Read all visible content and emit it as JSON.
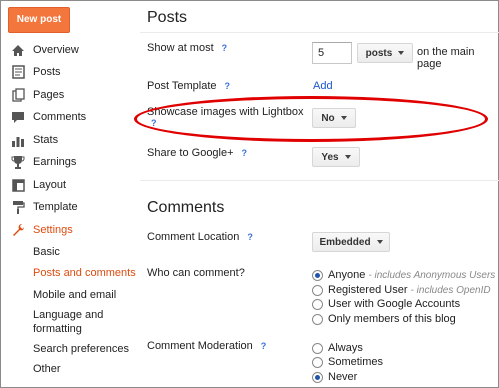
{
  "sidebar": {
    "new_post": "New post",
    "items": [
      {
        "label": "Overview",
        "icon": "home-icon"
      },
      {
        "label": "Posts",
        "icon": "posts-icon"
      },
      {
        "label": "Pages",
        "icon": "pages-icon"
      },
      {
        "label": "Comments",
        "icon": "comments-icon"
      },
      {
        "label": "Stats",
        "icon": "stats-icon"
      },
      {
        "label": "Earnings",
        "icon": "trophy-icon"
      },
      {
        "label": "Layout",
        "icon": "layout-icon"
      },
      {
        "label": "Template",
        "icon": "paint-roller-icon"
      },
      {
        "label": "Settings",
        "icon": "wrench-icon"
      }
    ],
    "sub_items": [
      "Basic",
      "Posts and comments",
      "Mobile and email",
      "Language and formatting",
      "Search preferences",
      "Other"
    ]
  },
  "posts": {
    "heading": "Posts",
    "show_at_most_label": "Show at most",
    "show_at_most_value": "5",
    "show_at_most_unit": "posts",
    "show_at_most_suffix": "on the main page",
    "post_template_label": "Post Template",
    "post_template_link": "Add",
    "lightbox_label": "Showcase images with Lightbox",
    "lightbox_value": "No",
    "share_label": "Share to Google+",
    "share_value": "Yes"
  },
  "comments": {
    "heading": "Comments",
    "location_label": "Comment Location",
    "location_value": "Embedded",
    "who_label": "Who can comment?",
    "who_options": [
      {
        "label": "Anyone",
        "hint": "- includes Anonymous Users",
        "selected": true
      },
      {
        "label": "Registered User",
        "hint": "- includes OpenID",
        "selected": false
      },
      {
        "label": "User with Google Accounts",
        "hint": "",
        "selected": false
      },
      {
        "label": "Only members of this blog",
        "hint": "",
        "selected": false
      }
    ],
    "moderation_label": "Comment Moderation",
    "moderation_options": [
      {
        "label": "Always",
        "selected": false
      },
      {
        "label": "Sometimes",
        "selected": false
      },
      {
        "label": "Never",
        "selected": true
      }
    ]
  },
  "help_glyph": "?",
  "colors": {
    "accent": "#dd4b0f",
    "button": "#f3763d",
    "link": "#1a55c9",
    "annotation": "#e00000"
  }
}
